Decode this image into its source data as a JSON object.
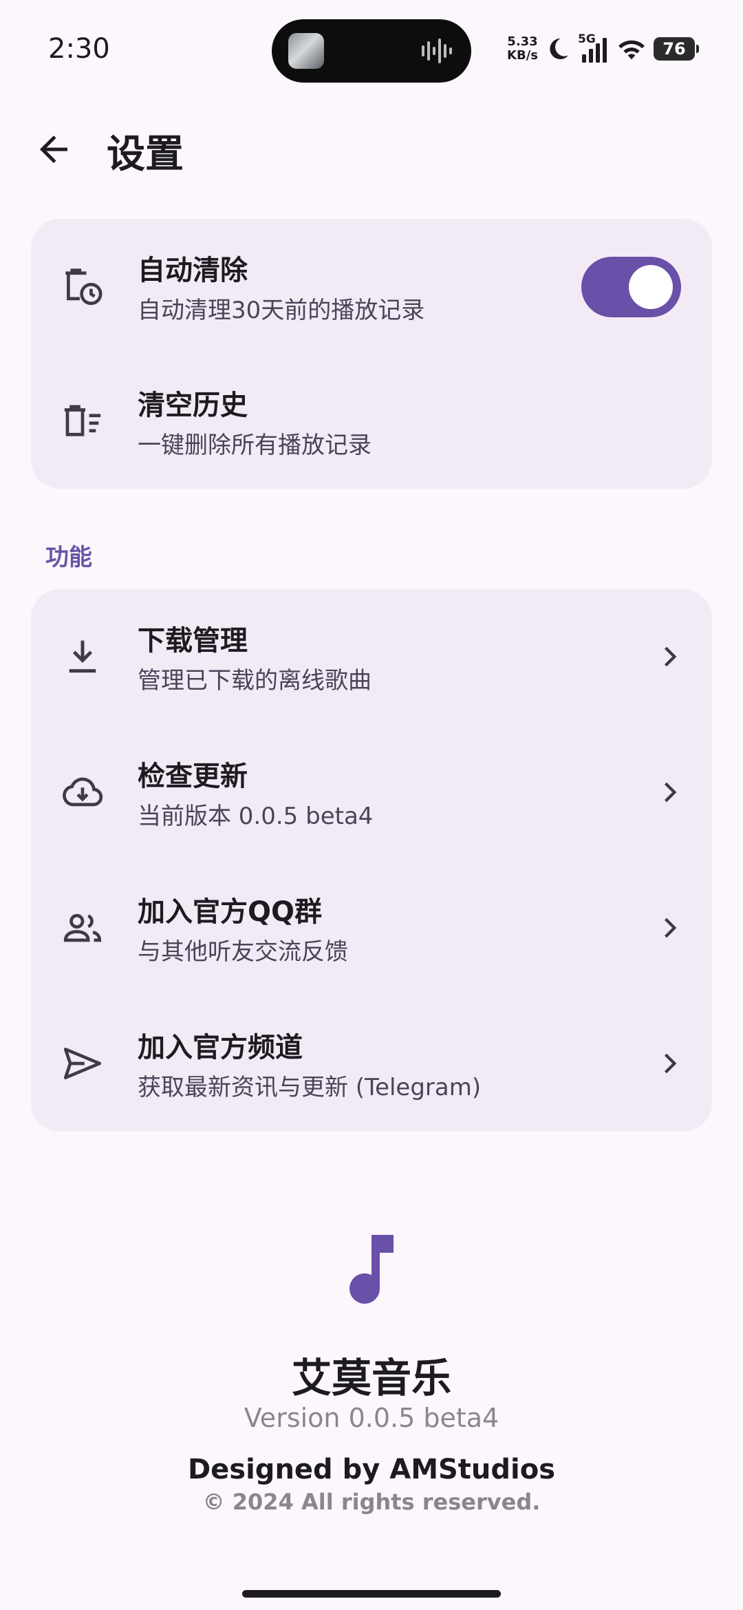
{
  "status_bar": {
    "time": "2:30",
    "net_speed_value": "5.33",
    "net_speed_unit": "KB/s",
    "network": "5G",
    "battery": "76",
    "icons": [
      "moon-icon",
      "signal-icon",
      "wifi-icon",
      "battery-icon"
    ]
  },
  "header": {
    "title": "设置",
    "back_icon": "arrow-left-icon"
  },
  "history_card": {
    "items": [
      {
        "title": "自动清除",
        "subtitle": "自动清理30天前的播放记录",
        "icon": "delete-clock-icon",
        "control": "toggle",
        "toggle_on": true
      },
      {
        "title": "清空历史",
        "subtitle": "一键删除所有播放记录",
        "icon": "delete-sweep-icon"
      }
    ]
  },
  "features_section": {
    "label": "功能",
    "items": [
      {
        "title": "下载管理",
        "subtitle": "管理已下载的离线歌曲",
        "icon": "download-icon"
      },
      {
        "title": "检查更新",
        "subtitle": "当前版本 0.0.5 beta4",
        "icon": "cloud-download-icon"
      },
      {
        "title": "加入官方QQ群",
        "subtitle": "与其他听友交流反馈",
        "icon": "group-icon"
      },
      {
        "title": "加入官方频道",
        "subtitle": "获取最新资讯与更新 (Telegram)",
        "icon": "send-icon"
      }
    ]
  },
  "footer": {
    "logo_icon": "music-note-icon",
    "app_name": "艾莫音乐",
    "version": "Version 0.0.5 beta4",
    "designed_by": "Designed by AMStudios",
    "copyright": "© 2024 All rights reserved."
  },
  "colors": {
    "background": "#fcf7fd",
    "card": "#f2ebf6",
    "accent": "#6950a8",
    "section_label": "#6a54a5",
    "subtitle": "#4a4458",
    "muted": "#8a8690"
  }
}
